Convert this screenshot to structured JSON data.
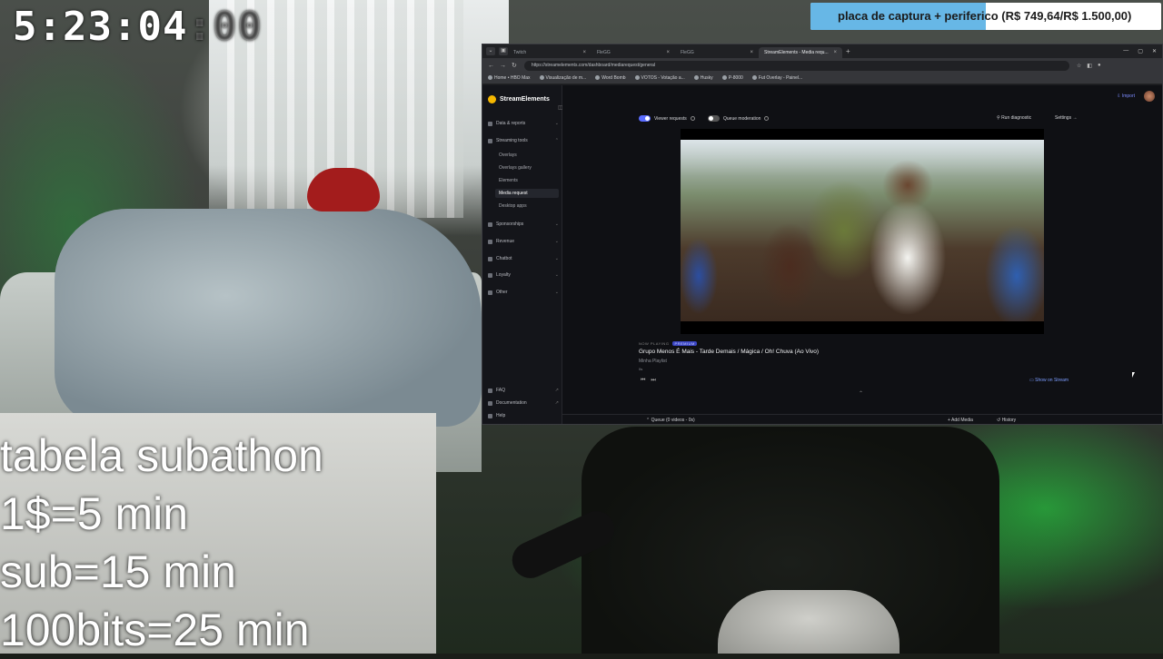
{
  "overlay": {
    "timer": "5:23:04",
    "timer_ms": ":00",
    "goal_text": "placa de captura + periferico (R$ 749,64/R$ 1.500,00)",
    "goal_progress": 0.4998,
    "subathon_lines": [
      "tabela subathon",
      "1$=5 min",
      "sub=15 min",
      "100bits=25 min"
    ]
  },
  "browser": {
    "tabs": [
      "Twitch",
      "FleGG",
      "FleGG",
      "StreamElements - Media requ..."
    ],
    "url": "https://streamelements.com/dashboard/mediarequest/general",
    "bookmarks": [
      "Home • HBO Max",
      "Visualização de m...",
      "Word Bomb",
      "VOTOS - Votação a...",
      "Husky",
      "P-8000",
      "Fut Overlay - Painel..."
    ]
  },
  "sidebar": {
    "brand": "StreamElements",
    "items": [
      "Data & reports",
      "Streaming tools",
      "Sponsorships",
      "Revenue",
      "Chatbot",
      "Loyalty",
      "Other"
    ],
    "streaming_tools": [
      "Overlays",
      "Overlays gallery",
      "Elements",
      "Media request",
      "Desktop apps"
    ],
    "bottom": [
      "FAQ",
      "Documentation",
      "Help"
    ]
  },
  "main": {
    "import_label": "Import",
    "viewer_requests": "Viewer requests",
    "queue_moderation": "Queue moderation",
    "run_diagnostic": "Run diagnostic",
    "settings": "Settings",
    "now_playing": "NOW PLAYING",
    "np_badge": "PREMIUM",
    "song_title": "Grupo Menos É Mais - Tarde Demais / Mágica / Oh! Chuva (Ao Vivo)",
    "playlist": "Minha Playlist",
    "duration": "0s",
    "show_on_stream": "Show on Stream",
    "queue": "Queue (0 videos - 0s)",
    "add_media": "Add Media",
    "history": "History"
  }
}
